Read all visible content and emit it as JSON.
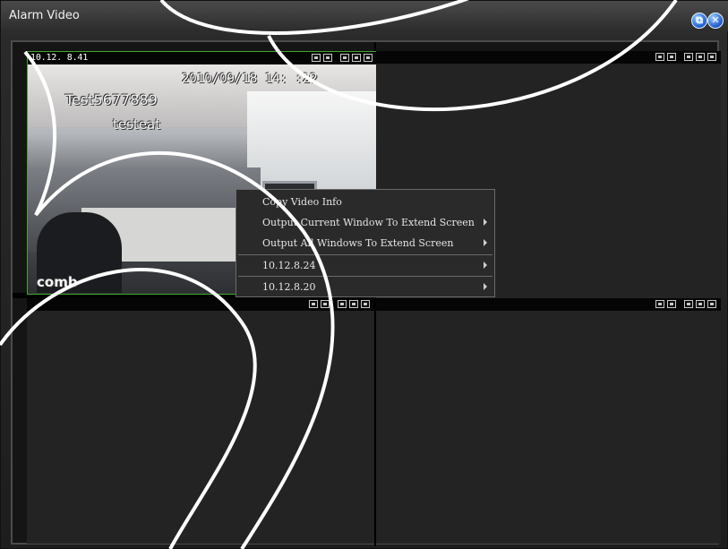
{
  "window": {
    "title": "Alarm Video"
  },
  "titlebar_icons": {
    "restore": "restore-icon",
    "close": "close-icon"
  },
  "panes": [
    {
      "label": "10.12. 8.41"
    },
    {
      "label": ""
    },
    {
      "label": ""
    },
    {
      "label": ""
    }
  ],
  "overlay": {
    "datetime": "2010/09/18  14:  :22",
    "line1": "Test5677889",
    "line2": "testeat",
    "line3": "comb"
  },
  "context_menu": {
    "items": [
      {
        "label": "Copy Video Info",
        "has_submenu": false
      },
      {
        "label": "Output Current Window To Extend Screen",
        "has_submenu": true
      },
      {
        "label": "Output All Windows To Extend Screen",
        "has_submenu": true
      },
      {
        "label": "10.12.8.24",
        "has_submenu": true
      },
      {
        "label": "10.12.8.20",
        "has_submenu": true
      }
    ]
  },
  "colors": {
    "active_border": "#41a72f",
    "window_bg": "#232323"
  }
}
